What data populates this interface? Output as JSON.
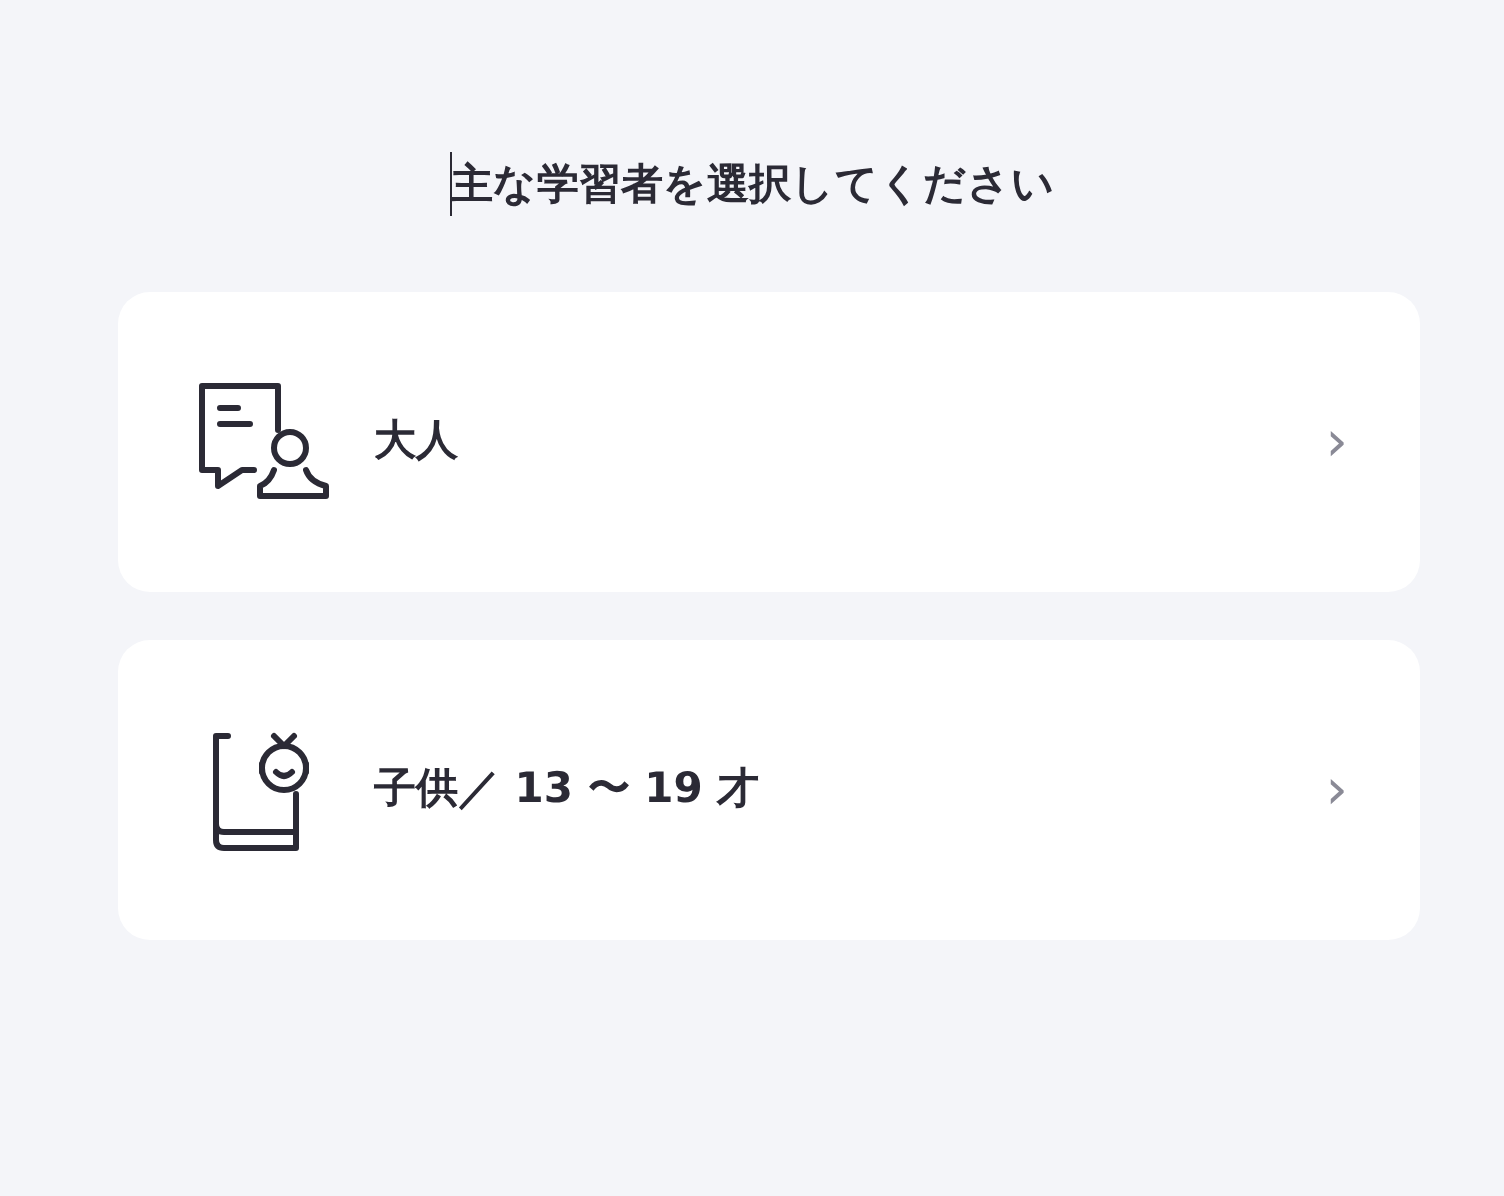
{
  "heading": "主な学習者を選択してください",
  "options": [
    {
      "kind": "adult",
      "label": "大人",
      "chevron": "›"
    },
    {
      "kind": "child",
      "label": "子供／ 13 〜 19 才",
      "chevron": "›"
    }
  ]
}
